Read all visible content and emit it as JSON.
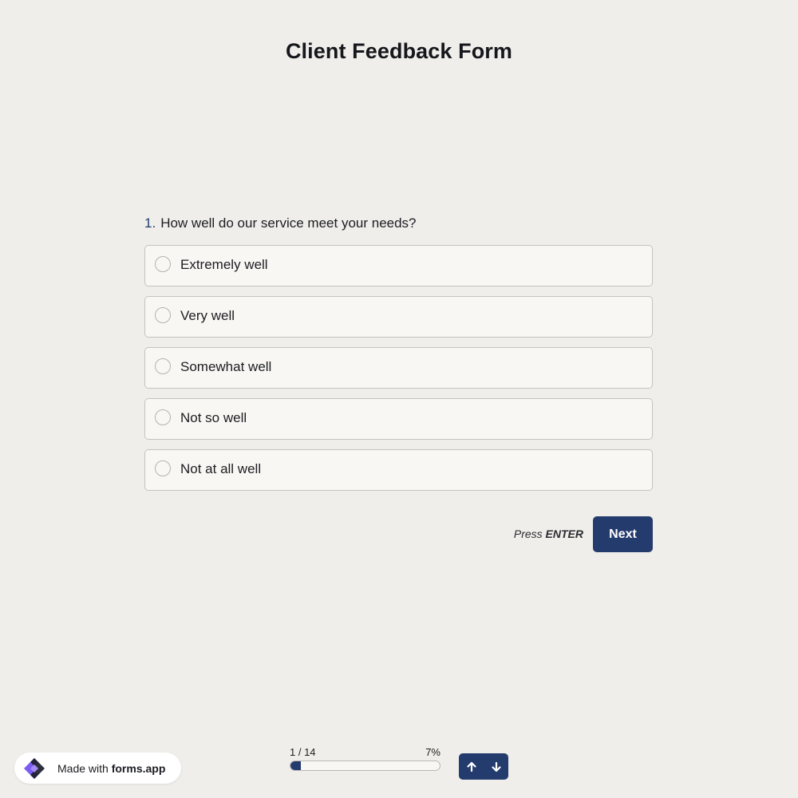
{
  "form": {
    "title": "Client Feedback Form"
  },
  "question": {
    "number": "1.",
    "text": "How well do our service meet your needs?",
    "options": [
      {
        "label": "Extremely well"
      },
      {
        "label": "Very well"
      },
      {
        "label": "Somewhat well"
      },
      {
        "label": "Not so well"
      },
      {
        "label": "Not at all well"
      }
    ]
  },
  "actions": {
    "hint_prefix": "Press",
    "hint_key": "ENTER",
    "next_label": "Next"
  },
  "footer": {
    "badge_prefix": "Made with",
    "badge_brand": "forms.app",
    "progress_text": "1 / 14",
    "progress_percent_text": "7%",
    "progress_fraction": 0.07
  },
  "colors": {
    "accent": "#243b6e",
    "background": "#efeeea",
    "option_bg": "#f8f7f3",
    "logo_purple": "#7b5cf0",
    "logo_dark": "#1c1d2b"
  },
  "icons": {
    "logo": "forms-app-logo-icon",
    "up": "arrow-up-icon",
    "down": "arrow-down-icon"
  }
}
